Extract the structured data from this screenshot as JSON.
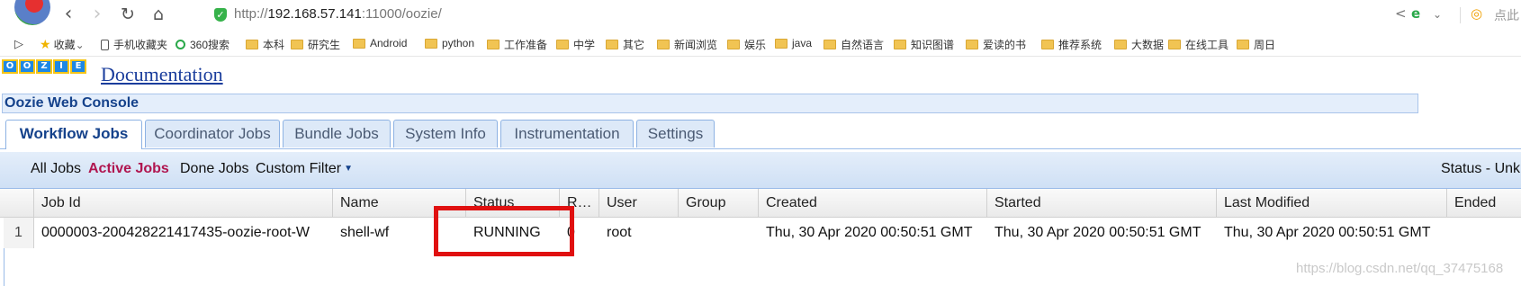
{
  "browser": {
    "url_prefix": "http://",
    "url_host": "192.168.57.141",
    "url_rest": ":11000/oozie/",
    "right_text": "点此",
    "icons": [
      "back-icon",
      "forward-icon",
      "reload-icon",
      "home-icon",
      "shield-icon",
      "share-icon",
      "ie-icon",
      "chevron-down-icon",
      "search-icon"
    ]
  },
  "bookmarks": {
    "items": [
      {
        "label": "收藏",
        "icon": "star-icon"
      },
      {
        "label": "手机收藏夹",
        "icon": "phone-icon"
      },
      {
        "label": "360搜索",
        "icon": "ring-icon"
      },
      {
        "label": "本科",
        "icon": "folder-icon"
      },
      {
        "label": "研究生",
        "icon": "folder-icon"
      },
      {
        "label": "Android",
        "icon": "folder-icon"
      },
      {
        "label": "python",
        "icon": "folder-icon"
      },
      {
        "label": "工作准备",
        "icon": "folder-icon"
      },
      {
        "label": "中学",
        "icon": "folder-icon"
      },
      {
        "label": "其它",
        "icon": "folder-icon"
      },
      {
        "label": "新闻浏览",
        "icon": "folder-icon"
      },
      {
        "label": "娱乐",
        "icon": "folder-icon"
      },
      {
        "label": "java",
        "icon": "folder-icon"
      },
      {
        "label": "自然语言",
        "icon": "folder-icon"
      },
      {
        "label": "知识图谱",
        "icon": "folder-icon"
      },
      {
        "label": "爱读的书",
        "icon": "folder-icon"
      },
      {
        "label": "推荐系统",
        "icon": "folder-icon"
      },
      {
        "label": "大数据",
        "icon": "folder-icon"
      },
      {
        "label": "在线工具",
        "icon": "folder-icon"
      },
      {
        "label": "周日",
        "icon": "folder-icon"
      }
    ]
  },
  "header": {
    "logo_letters": [
      "O",
      "O",
      "Z",
      "I",
      "E"
    ],
    "documentation_link": "Documentation",
    "console_title": "Oozie Web Console"
  },
  "tabs": [
    {
      "label": "Workflow Jobs",
      "active": true
    },
    {
      "label": "Coordinator Jobs",
      "active": false
    },
    {
      "label": "Bundle Jobs",
      "active": false
    },
    {
      "label": "System Info",
      "active": false
    },
    {
      "label": "Instrumentation",
      "active": false
    },
    {
      "label": "Settings",
      "active": false
    }
  ],
  "filters": {
    "all_jobs": "All Jobs",
    "active_jobs": "Active Jobs",
    "done_jobs": "Done Jobs",
    "custom_filter": "Custom Filter",
    "status_text": "Status - Unk"
  },
  "grid": {
    "columns": [
      "",
      "Job Id",
      "Name",
      "Status",
      "R…",
      "User",
      "Group",
      "Created",
      "Started",
      "Last Modified",
      "Ended"
    ],
    "rows": [
      {
        "num": "1",
        "job_id": "0000003-200428221417435-oozie-root-W",
        "name": "shell-wf",
        "status": "RUNNING",
        "run": "0",
        "user": "root",
        "group": "",
        "created": "Thu, 30 Apr 2020 00:50:51 GMT",
        "started": "Thu, 30 Apr 2020 00:50:51 GMT",
        "last_modified": "Thu, 30 Apr 2020 00:50:51 GMT",
        "ended": ""
      }
    ]
  },
  "watermark": "https://blog.csdn.net/qq_37475168"
}
